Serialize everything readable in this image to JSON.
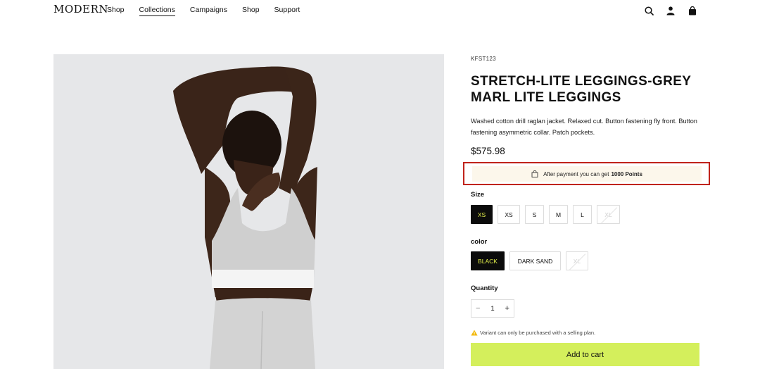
{
  "header": {
    "logo": "MODERN",
    "nav": [
      "Shop",
      "Collections",
      "Campaigns",
      "Shop",
      "Support"
    ],
    "active_nav_index": 1,
    "icons": [
      "search-icon",
      "account-icon",
      "cart-icon"
    ]
  },
  "product": {
    "sku": "KFST123",
    "title": "STRETCH-LITE LEGGINGS-GREY MARL LITE LEGGINGS",
    "description": "Washed cotton drill raglan jacket. Relaxed cut. Button fastening fly front. Button fastening asymmetric collar. Patch pockets.",
    "price": "$575.98",
    "points": {
      "text": "After payment you can get",
      "amount": "1000 Points",
      "icon": "shopping-bag-icon"
    },
    "size": {
      "label": "Size",
      "options": [
        "XS",
        "XS",
        "S",
        "M",
        "L",
        "XL"
      ],
      "selected_index": 0,
      "disabled_index": 5
    },
    "color": {
      "label": "color",
      "options": [
        "BLACK",
        "DARK SAND",
        "XL"
      ],
      "selected_index": 0,
      "disabled_index": 2
    },
    "quantity": {
      "label": "Quantity",
      "minus": "−",
      "value": "1",
      "plus": "+"
    },
    "warning": "Variant can only be purchased with a selling plan.",
    "add_to_cart": "Add to cart"
  },
  "colors": {
    "accent": "#d4ef5c",
    "selected_text": "#e4f04a",
    "highlight_border": "#c0231b",
    "points_bg": "#fcf7eb",
    "image_bg": "#e6e7e9"
  }
}
